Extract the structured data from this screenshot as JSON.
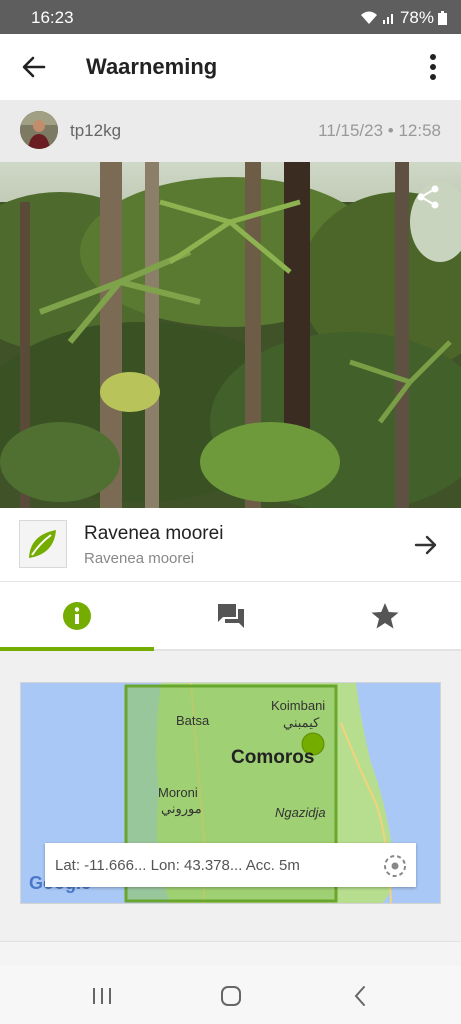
{
  "status_bar": {
    "time": "16:23",
    "battery": "78%"
  },
  "app_bar": {
    "title": "Waarneming",
    "back_icon": "arrow-left-icon",
    "menu_icon": "more-vert-icon"
  },
  "observation": {
    "username": "tp12kg",
    "datetime": "11/15/23 • 12:58"
  },
  "species": {
    "name": "Ravenea moorei",
    "scientific_name": "Ravenea moorei"
  },
  "tabs": [
    {
      "name": "info",
      "icon": "info-icon",
      "active": true
    },
    {
      "name": "comments",
      "icon": "chat-icon",
      "active": false
    },
    {
      "name": "favorite",
      "icon": "star-icon",
      "active": false
    }
  ],
  "map": {
    "labels": {
      "koimbani": "Koimbani",
      "koimbani_ar": "كيمبني",
      "batsa": "Batsa",
      "comoros": "Comoros",
      "moroni": "Moroni",
      "moroni_ar": "موروني",
      "ngazidja": "Ngazidja"
    },
    "coordinates_text": "Lat: -11.666... Lon: 43.378... Acc. 5m",
    "provider": "Google"
  },
  "colors": {
    "accent": "#74ac00",
    "status_bar": "#5e5e5e",
    "water": "#a9c8f6",
    "land": "#b7de8f"
  }
}
